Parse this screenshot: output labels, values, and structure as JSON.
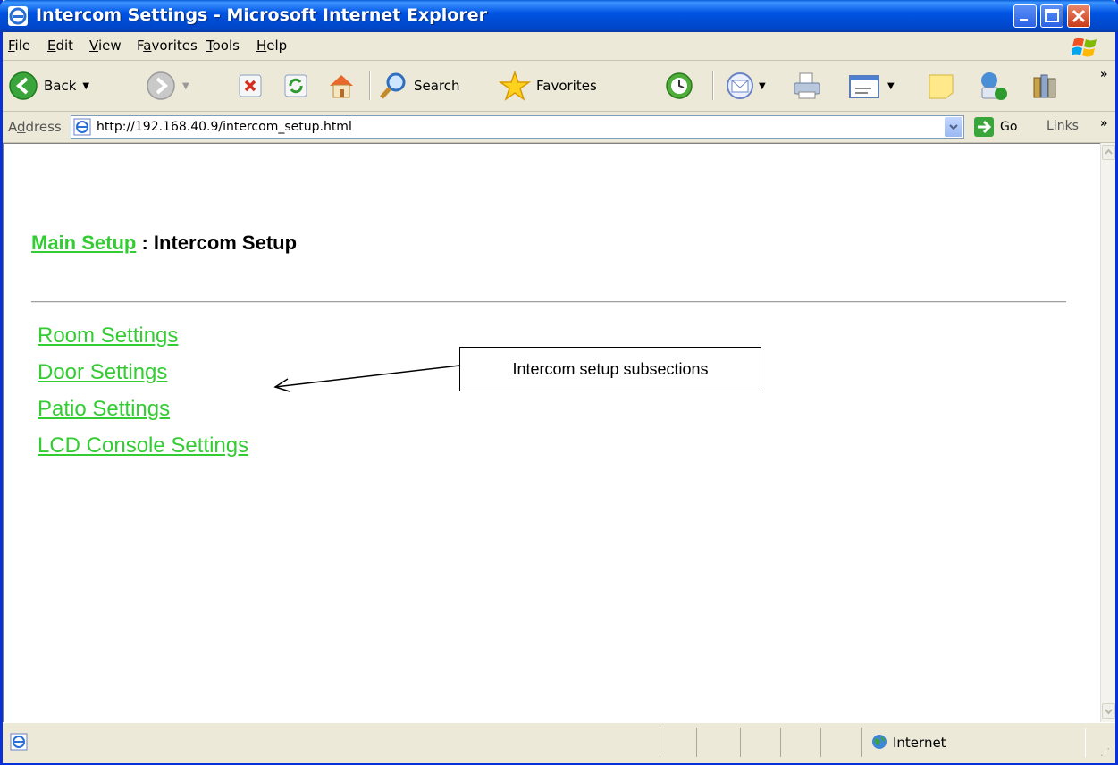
{
  "window": {
    "title": "Intercom Settings - Microsoft Internet Explorer"
  },
  "menu": {
    "items": [
      {
        "first": "F",
        "rest": "ile"
      },
      {
        "first": "E",
        "rest": "dit"
      },
      {
        "first": "V",
        "rest": "iew"
      },
      {
        "pre": "F",
        "first": "a",
        "rest": "vorites"
      },
      {
        "first": "T",
        "rest": "ools"
      },
      {
        "first": "H",
        "rest": "elp"
      }
    ]
  },
  "toolbar": {
    "back_label": "Back",
    "search_label": "Search",
    "favorites_label": "Favorites",
    "overflow": "»"
  },
  "address": {
    "label_pre": "A",
    "label_u": "d",
    "label_rest": "dress",
    "url": "http://192.168.40.9/intercom_setup.html",
    "go_label": "Go",
    "links_label": "Links",
    "links_overflow": "»"
  },
  "page": {
    "breadcrumb_link": "Main Setup",
    "breadcrumb_sep": " : ",
    "breadcrumb_current": "Intercom Setup",
    "links": [
      "Room Settings",
      "Door Settings",
      "Patio Settings",
      "LCD Console Settings"
    ],
    "callout": "Intercom setup subsections"
  },
  "status": {
    "zone": "Internet"
  },
  "colors": {
    "link": "#33cc33",
    "titlebar": "#0054e3",
    "chrome": "#ece9d8"
  }
}
